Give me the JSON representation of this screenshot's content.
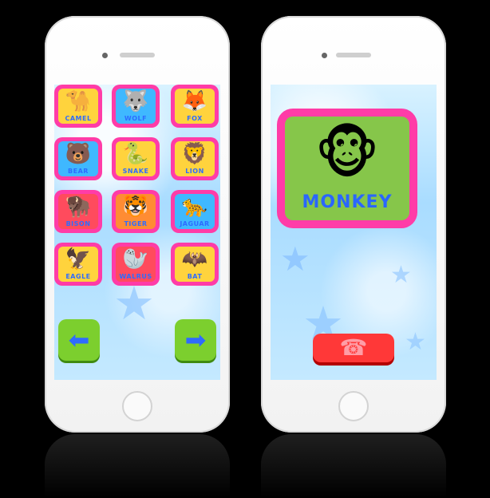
{
  "left_screen": {
    "tiles": [
      {
        "label": "CAMEL",
        "icon": "camel-icon",
        "glyph": "🐪"
      },
      {
        "label": "WOLF",
        "icon": "wolf-icon",
        "glyph": "🐺"
      },
      {
        "label": "FOX",
        "icon": "fox-icon",
        "glyph": "🦊"
      },
      {
        "label": "BEAR",
        "icon": "bear-icon",
        "glyph": "🐻"
      },
      {
        "label": "SNAKE",
        "icon": "snake-icon",
        "glyph": "🐍"
      },
      {
        "label": "LION",
        "icon": "lion-icon",
        "glyph": "🦁"
      },
      {
        "label": "BISON",
        "icon": "bison-icon",
        "glyph": "🦬"
      },
      {
        "label": "TIGER",
        "icon": "tiger-icon",
        "glyph": "🐯"
      },
      {
        "label": "JAGUAR",
        "icon": "jaguar-icon",
        "glyph": "🐆"
      },
      {
        "label": "EAGLE",
        "icon": "eagle-icon",
        "glyph": "🦅"
      },
      {
        "label": "WALRUS",
        "icon": "walrus-icon",
        "glyph": "🦭"
      },
      {
        "label": "BAT",
        "icon": "bat-icon",
        "glyph": "🦇"
      }
    ],
    "nav": {
      "left_glyph": "⬅",
      "right_glyph": "➡"
    }
  },
  "right_screen": {
    "animal_name": "MONKEY",
    "animal_glyph": "🐵",
    "hangup_glyph": "☎"
  },
  "colors": {
    "frame_pink": "#ff3ca7",
    "label_blue": "#2e6cff",
    "button_green": "#7ccf2e",
    "hangup_red": "#ff3838"
  }
}
